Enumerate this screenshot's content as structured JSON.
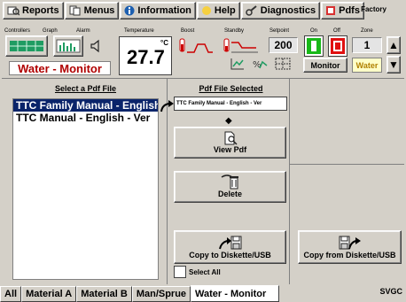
{
  "menu": {
    "items": [
      {
        "label": "Reports",
        "icon": "reports-icon"
      },
      {
        "label": "Menus",
        "icon": "menus-icon"
      },
      {
        "label": "Information",
        "icon": "information-icon"
      },
      {
        "label": "Help",
        "icon": "help-icon"
      },
      {
        "label": "Diagnostics",
        "icon": "diagnostics-icon"
      },
      {
        "label": "Pdfs",
        "icon": "pdfs-icon"
      }
    ],
    "factory_label": "Factory"
  },
  "toolbar": {
    "labels": {
      "controllers": "Controllers",
      "graph": "Graph",
      "alarm": "Alarm",
      "temperature": "Temperature",
      "boost": "Boost",
      "standby": "Standby",
      "setpoint": "Setpoint",
      "on": "On",
      "off": "Off",
      "zone": "Zone"
    },
    "temperature_value": "27.7",
    "temperature_unit": "°C",
    "setpoint_value": "200",
    "zone_value": "1",
    "title": "Water - Monitor",
    "monitor_label": "Monitor",
    "water_label": "Water",
    "colors": {
      "title": "#b00000",
      "on": "#18b818",
      "off": "#e01010",
      "water_bg": "#ffffc8"
    }
  },
  "pdf": {
    "select_title": "Select a Pdf File",
    "files": [
      "TTC Family Manual - English",
      "TTC Manual - English - Ver"
    ],
    "selected_title": "Pdf File Selected",
    "selected_file": "TTC Family Manual - English - Ver",
    "view_label": "View Pdf",
    "delete_label": "Delete",
    "copy_to_label": "Copy to Diskette/USB",
    "copy_from_label": "Copy from Diskette/USB",
    "select_all_label": "Select All"
  },
  "tabs": [
    "All",
    "Material A",
    "Material B",
    "Man/Sprue",
    "Water - Monitor"
  ],
  "active_tab": "Water - Monitor",
  "corner_label": "SVGC"
}
